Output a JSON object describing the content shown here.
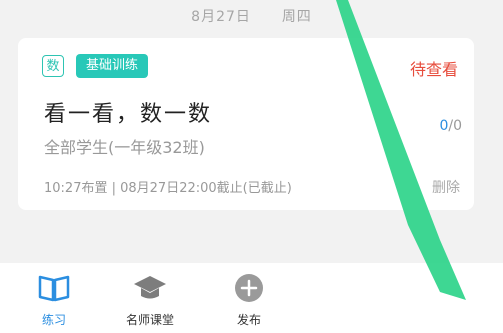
{
  "header": {
    "date": "8月27日",
    "weekday": "周四"
  },
  "card": {
    "subject_badge": "数",
    "type_tag": "基础训练",
    "status": "待查看",
    "title": "看一看，数一数",
    "class_info": "全部学生(一年级32班)",
    "count_done": "0",
    "count_total": "/0",
    "meta": "10:27布置  |  08月27日22:00截止(已截止)",
    "delete_label": "删除"
  },
  "nav": {
    "items": [
      {
        "label": "练习",
        "icon": "book-icon",
        "active": true
      },
      {
        "label": "名师课堂",
        "icon": "graduation-cap-icon",
        "active": false
      },
      {
        "label": "发布",
        "icon": "plus-circle-icon",
        "active": false
      }
    ]
  },
  "colors": {
    "accent": "#2b8ee0",
    "teal": "#28c8b8",
    "status": "#e74c3c",
    "overlay": "#2ed48a"
  }
}
